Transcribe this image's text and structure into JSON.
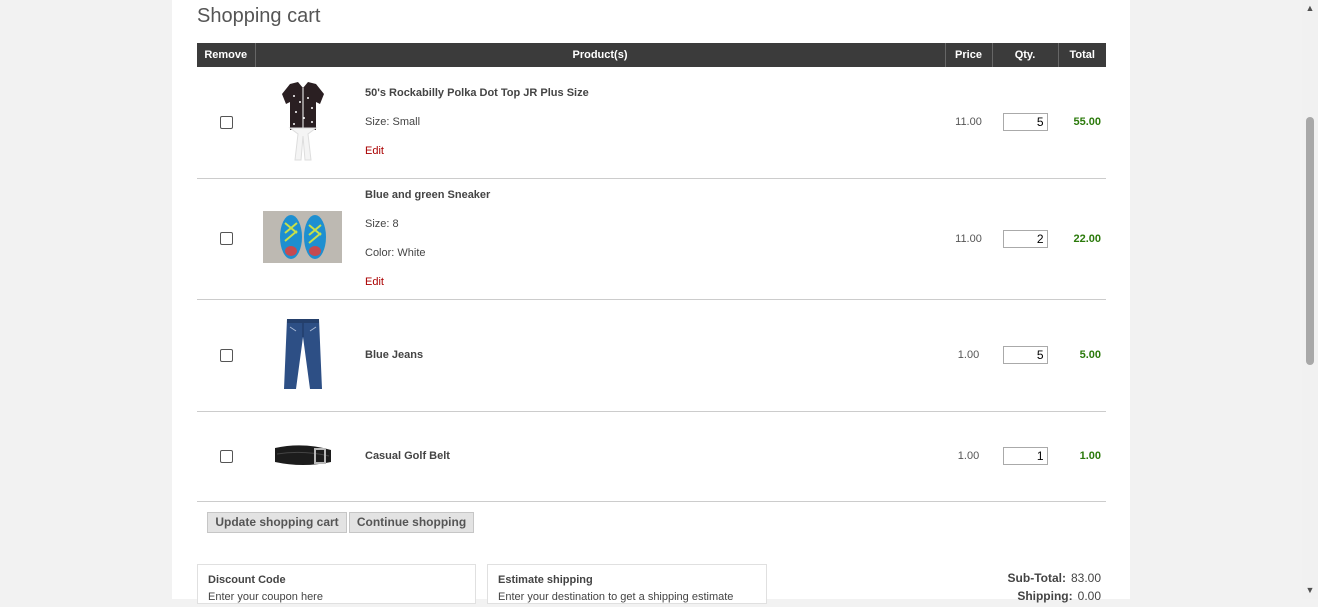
{
  "page": {
    "title": "Shopping cart"
  },
  "table": {
    "headers": {
      "remove": "Remove",
      "product": "Product(s)",
      "price": "Price",
      "qty": "Qty.",
      "total": "Total"
    },
    "rows": [
      {
        "name": "50's Rockabilly Polka Dot Top JR Plus Size",
        "attr1": "Size: Small",
        "attr2": "",
        "edit": "Edit",
        "price": "11.00",
        "qty": "5",
        "total": "55.00",
        "image": "polka-dot-top-image"
      },
      {
        "name": "Blue and green Sneaker",
        "attr1": "Size: 8",
        "attr2": "Color: White",
        "edit": "Edit",
        "price": "11.00",
        "qty": "2",
        "total": "22.00",
        "image": "sneaker-image"
      },
      {
        "name": "Blue Jeans",
        "attr1": "",
        "attr2": "",
        "edit": "",
        "price": "1.00",
        "qty": "5",
        "total": "5.00",
        "image": "jeans-image"
      },
      {
        "name": "Casual Golf Belt",
        "attr1": "",
        "attr2": "",
        "edit": "",
        "price": "1.00",
        "qty": "1",
        "total": "1.00",
        "image": "belt-image"
      }
    ]
  },
  "buttons": {
    "update": "Update shopping cart",
    "continue": "Continue shopping"
  },
  "discount": {
    "title": "Discount Code",
    "desc": "Enter your coupon here"
  },
  "shipping": {
    "title": "Estimate shipping",
    "desc": "Enter your destination to get a shipping estimate"
  },
  "totals": {
    "subtotal_label": "Sub-Total:",
    "subtotal_value": "83.00",
    "shipping_label": "Shipping:",
    "shipping_value": "0.00"
  },
  "colors": {
    "header_bg": "#3b3b3b",
    "total_green": "#2b7a0b",
    "edit_red": "#aa0000"
  }
}
